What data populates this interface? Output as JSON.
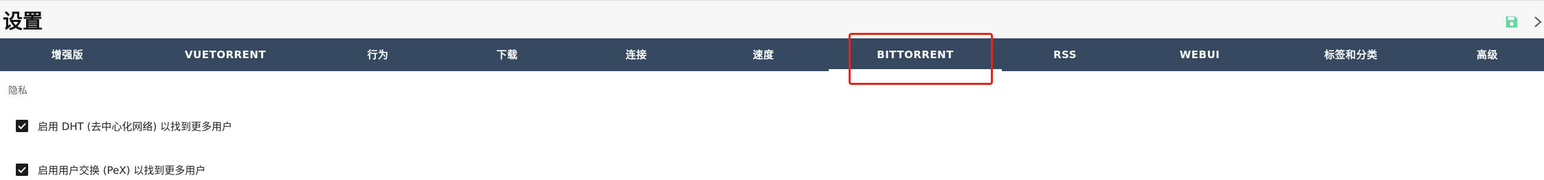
{
  "header": {
    "title": "设置",
    "icons": {
      "save": "save-icon",
      "close": "chevron-right-icon"
    }
  },
  "tabs": [
    {
      "label": "增强版"
    },
    {
      "label": "VUETORRENT"
    },
    {
      "label": "行为"
    },
    {
      "label": "下载"
    },
    {
      "label": "连接"
    },
    {
      "label": "速度"
    },
    {
      "label": "BITTORRENT",
      "active": true
    },
    {
      "label": "RSS"
    },
    {
      "label": "WEBUI"
    },
    {
      "label": "标签和分类"
    },
    {
      "label": "高级"
    }
  ],
  "content": {
    "section_label": "隐私",
    "options": [
      {
        "label": "启用 DHT (去中心化网络) 以找到更多用户",
        "checked": true
      },
      {
        "label": "启用用户交换 (PeX) 以找到更多用户",
        "checked": true
      }
    ]
  },
  "colors": {
    "tabbar_bg": "#34495e",
    "highlight": "#e1261c",
    "save_icon": "#6bd3a1"
  }
}
